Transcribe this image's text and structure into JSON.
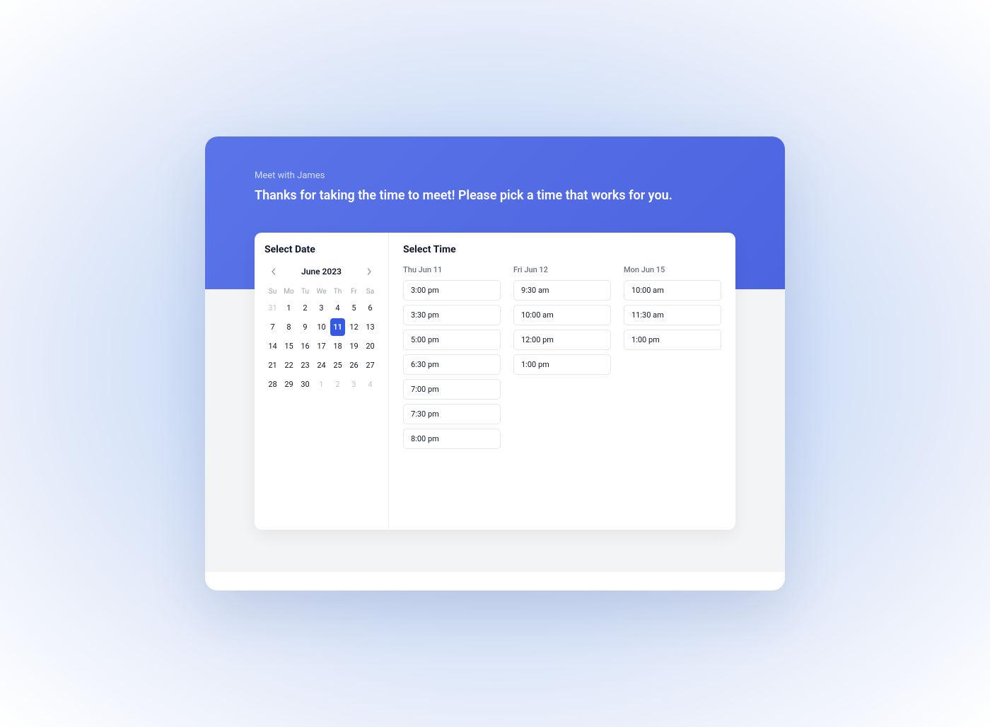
{
  "banner": {
    "subtitle": "Meet with James",
    "title": "Thanks for taking the time to meet! Please pick a time that works for you."
  },
  "date_panel": {
    "title": "Select Date",
    "month_label": "June 2023",
    "dow": [
      "Su",
      "Mo",
      "Tu",
      "We",
      "Th",
      "Fr",
      "Sa"
    ],
    "weeks": [
      [
        {
          "n": "31",
          "muted": true
        },
        {
          "n": "1"
        },
        {
          "n": "2"
        },
        {
          "n": "3"
        },
        {
          "n": "4"
        },
        {
          "n": "5"
        },
        {
          "n": "6"
        }
      ],
      [
        {
          "n": "7"
        },
        {
          "n": "8"
        },
        {
          "n": "9"
        },
        {
          "n": "10"
        },
        {
          "n": "11",
          "selected": true
        },
        {
          "n": "12"
        },
        {
          "n": "13"
        }
      ],
      [
        {
          "n": "14"
        },
        {
          "n": "15"
        },
        {
          "n": "16"
        },
        {
          "n": "17"
        },
        {
          "n": "18"
        },
        {
          "n": "19"
        },
        {
          "n": "20"
        }
      ],
      [
        {
          "n": "21"
        },
        {
          "n": "22"
        },
        {
          "n": "23"
        },
        {
          "n": "24"
        },
        {
          "n": "25"
        },
        {
          "n": "26"
        },
        {
          "n": "27"
        }
      ],
      [
        {
          "n": "28"
        },
        {
          "n": "29"
        },
        {
          "n": "30"
        },
        {
          "n": "1",
          "muted": true
        },
        {
          "n": "2",
          "muted": true
        },
        {
          "n": "3",
          "muted": true
        },
        {
          "n": "4",
          "muted": true
        }
      ]
    ]
  },
  "time_panel": {
    "title": "Select Time",
    "columns": [
      {
        "header": "Thu Jun 11",
        "slots": [
          "3:00 pm",
          "3:30 pm",
          "5:00 pm",
          "6:30 pm",
          "7:00 pm",
          "7:30 pm",
          "8:00 pm"
        ]
      },
      {
        "header": "Fri Jun 12",
        "slots": [
          "9:30 am",
          "10:00 am",
          "12:00 pm",
          "1:00 pm"
        ]
      },
      {
        "header": "Mon Jun 15",
        "slots": [
          "10:00 am",
          "11:30 am",
          "1:00 pm"
        ]
      }
    ]
  }
}
